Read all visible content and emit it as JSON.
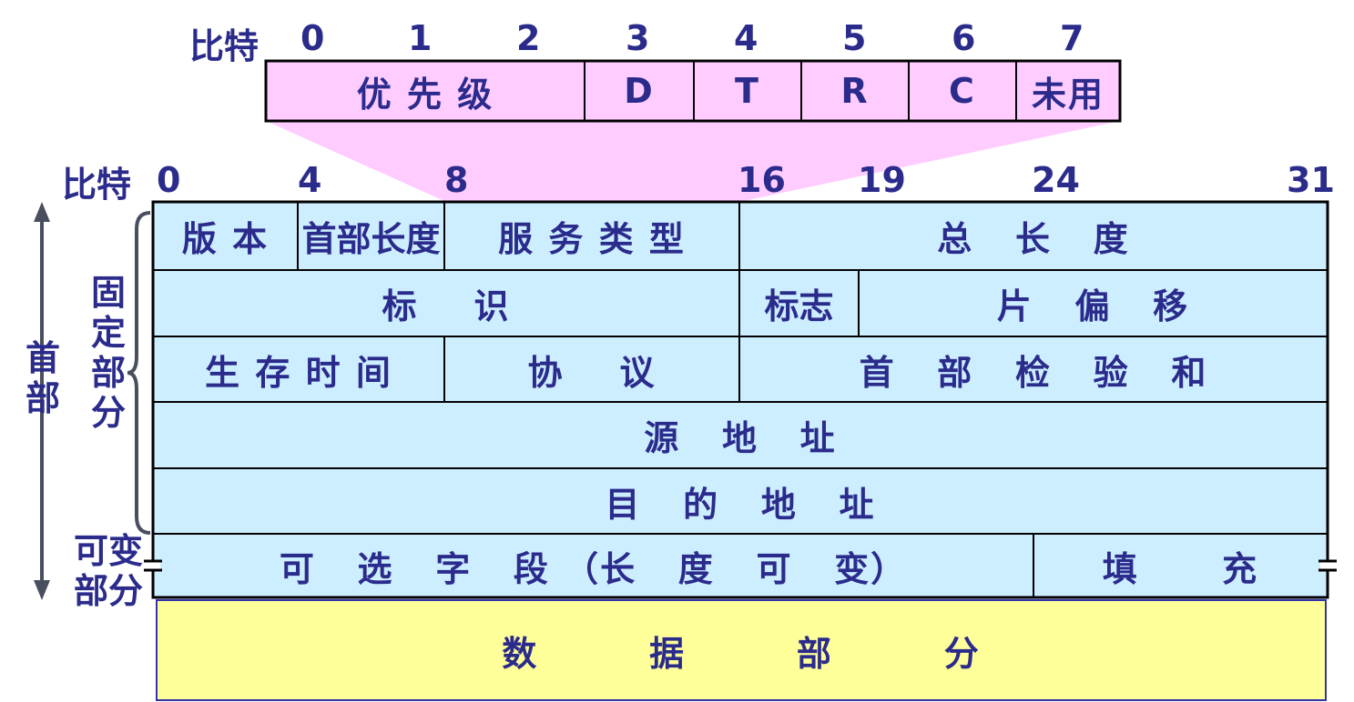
{
  "tos_byte": {
    "bit_label": "比特",
    "bit_numbers": [
      "0",
      "1",
      "2",
      "3",
      "4",
      "5",
      "6",
      "7"
    ],
    "fields": [
      "优 先 级",
      "D",
      "T",
      "R",
      "C",
      "未用"
    ]
  },
  "header": {
    "bit_label": "比特",
    "bit_numbers": [
      "0",
      "4",
      "8",
      "16",
      "19",
      "24",
      "31"
    ],
    "rows": {
      "row1": [
        "版 本",
        "首部长度",
        "服 务 类 型",
        "总   长   度"
      ],
      "row2": [
        "标    识",
        "标志",
        "片   偏   移"
      ],
      "row3": [
        "生 存 时 间",
        "协    议",
        "首   部   检   验   和"
      ],
      "row4": [
        "源   地   址"
      ],
      "row5": [
        "目   的   地   址"
      ],
      "row6": [
        "可   选   字   段 （长   度   可   变）",
        "填      充"
      ]
    },
    "data_part": "数        据        部        分"
  },
  "side_labels": {
    "header": [
      "首",
      "部"
    ],
    "fixed_part": [
      "固",
      "定",
      "部",
      "分"
    ],
    "variable_part": [
      "可变",
      "部分"
    ]
  },
  "colors": {
    "text": "#2b2b8c",
    "tos_fill": "#ffccff",
    "header_fill": "#cceeff",
    "data_fill": "#ffff99",
    "border": "#000000"
  }
}
